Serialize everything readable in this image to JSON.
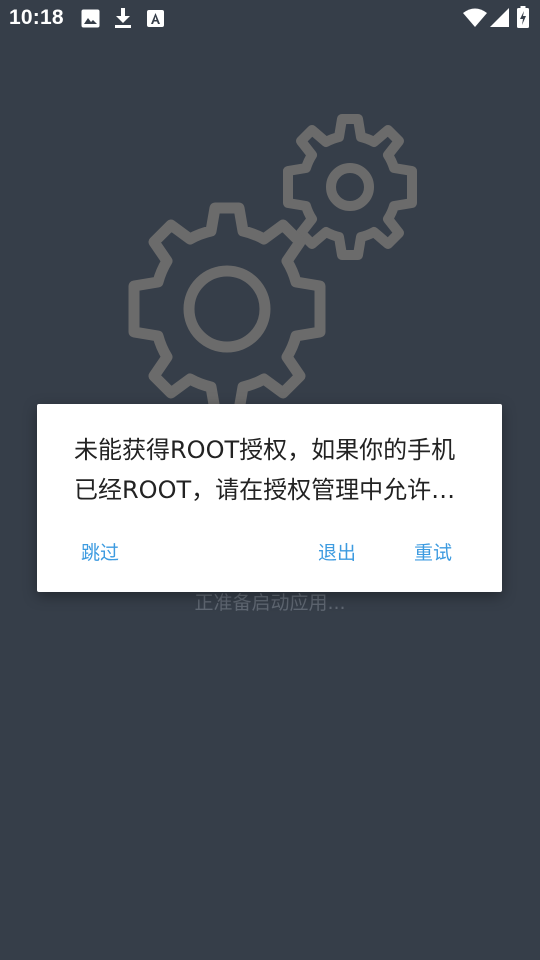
{
  "status_bar": {
    "time": "10:18",
    "left_icons": [
      "image-icon",
      "download-icon",
      "font-a-icon"
    ],
    "right_icons": [
      "wifi-icon",
      "signal-icon",
      "battery-charging-icon"
    ]
  },
  "background": {
    "illustration": "gears-icon",
    "loading_text": "正准备启动应用..."
  },
  "dialog": {
    "message": "未能获得ROOT授权，如果你的手机已经ROOT，请在授权管理中允许本应用使用ROOT权限",
    "buttons": {
      "skip": "跳过",
      "exit": "退出",
      "retry": "重试"
    }
  },
  "colors": {
    "background": "#363e49",
    "gear": "#6b6b6b",
    "accent": "#3d9be0",
    "dialog_bg": "#ffffff"
  }
}
